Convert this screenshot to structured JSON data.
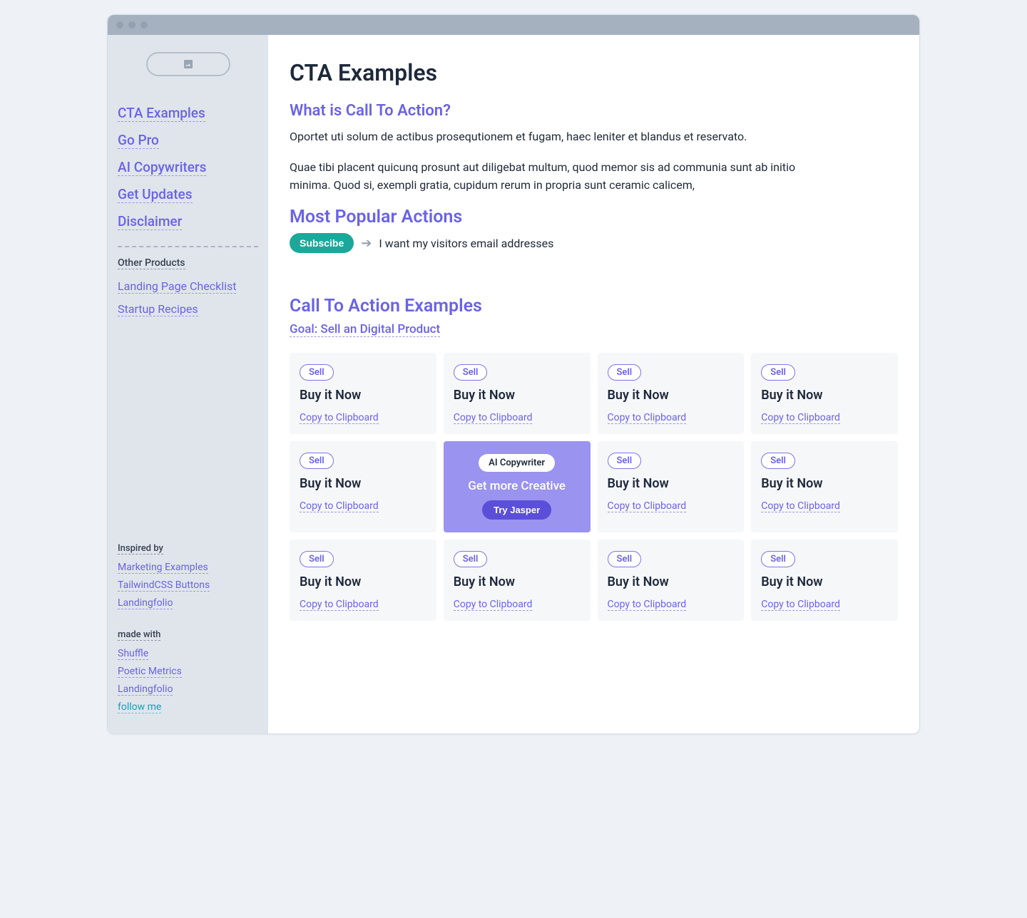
{
  "sidebar": {
    "nav": [
      "CTA Examples",
      "Go Pro",
      "AI Copywriters",
      "Get Updates",
      "Disclaimer"
    ],
    "other_products_head": "Other Products",
    "other_products": [
      "Landing Page Checklist",
      "Startup Recipes"
    ],
    "inspired_head": "Inspired by",
    "inspired": [
      "Marketing Examples",
      "TailwindCSS Buttons",
      "Landingfolio"
    ],
    "made_head": "made with",
    "made": [
      "Shuffle",
      "Poetic Metrics",
      "Landingfolio",
      "follow me"
    ]
  },
  "main": {
    "title": "CTA Examples",
    "section1": "What is Call To Action?",
    "para1": "Oportet uti solum de actibus prosequtionem et fugam, haec leniter et blandus et reservato.",
    "para2": "Quae tibi placent quicunq prosunt aut diligebat multum, quod memor sis ad communia sunt ab initio minima. Quod si, exempli gratia, cupidum rerum in propria sunt ceramic calicem,",
    "section2": "Most Popular Actions",
    "subscribe_btn": "Subscibe",
    "subscribe_text": "I want my visitors email addresses",
    "section3": "Call To Action Examples",
    "goal": "Goal: Sell an Digital Product",
    "card_tag": "Sell",
    "card_title": "Buy it Now",
    "card_copy": "Copy to Clipboard",
    "promo": {
      "badge": "AI Copywriter",
      "text": "Get more Creative",
      "button": "Try Jasper"
    }
  }
}
